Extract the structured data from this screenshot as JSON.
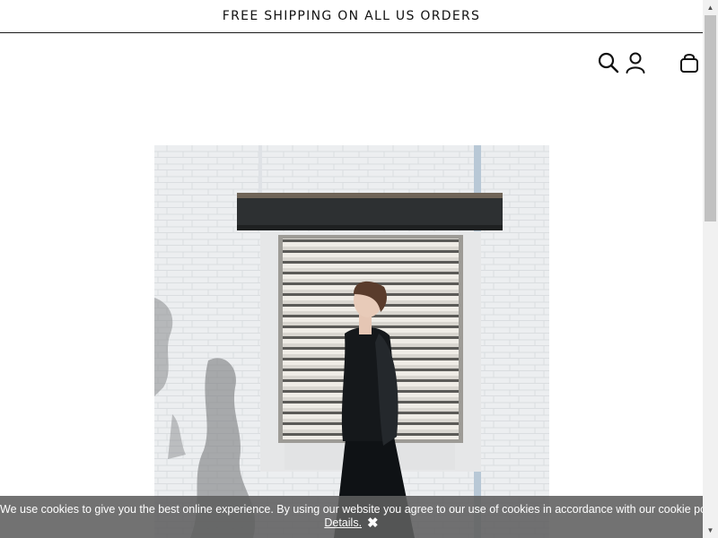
{
  "announcement": {
    "text": "FREE SHIPPING ON ALL US ORDERS"
  },
  "header": {
    "icons": {
      "search": "search-icon",
      "account": "account-icon",
      "cart": "bag-icon"
    }
  },
  "hero": {
    "image": "model-in-black-dress-by-white-brick-wall"
  },
  "cookie_banner": {
    "message": "We use cookies to give you the best online experience. By using our website you agree to our use of cookies in accordance with our cookie policy.",
    "details_label": "Details.",
    "close_symbol": "✖"
  },
  "scrollbar": {
    "up": "▲",
    "down": "▼"
  },
  "colors": {
    "text": "#111111",
    "banner_bg": "#5f5f5f",
    "banner_text": "#ffffff"
  }
}
